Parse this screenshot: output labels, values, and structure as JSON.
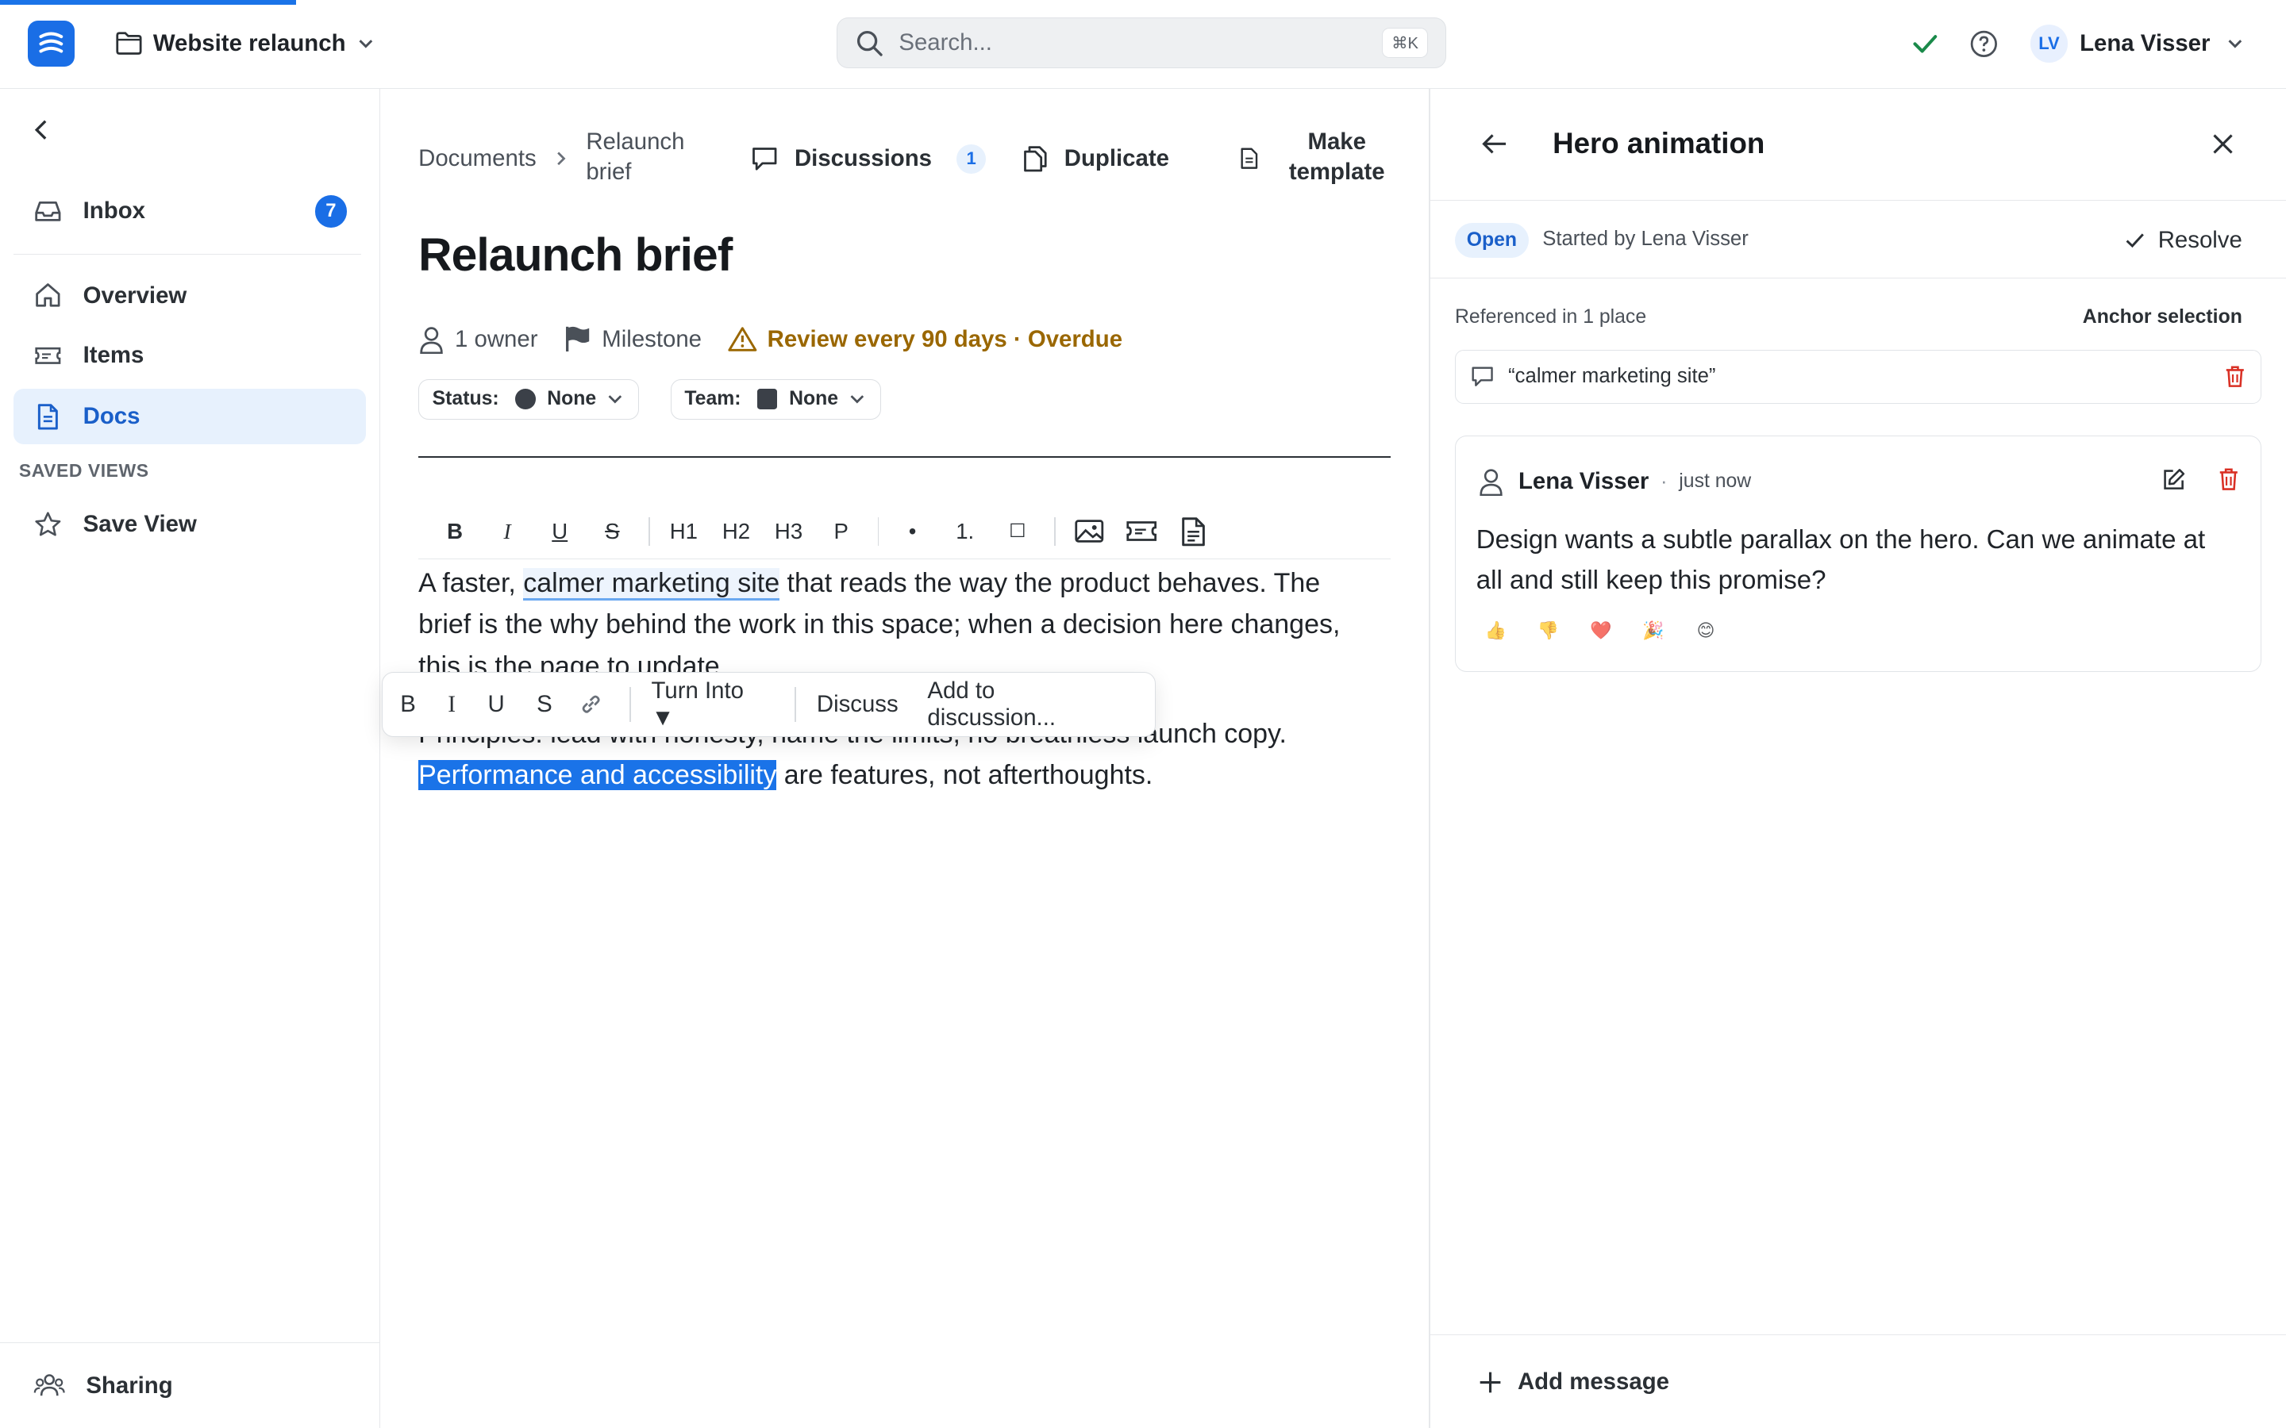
{
  "topbar": {
    "project_name": "Website relaunch",
    "search_placeholder": "Search...",
    "search_shortcut": "⌘K",
    "user_initials": "LV",
    "user_name": "Lena Visser"
  },
  "sidebar": {
    "inbox": {
      "label": "Inbox",
      "count": "7"
    },
    "items": [
      {
        "label": "Overview"
      },
      {
        "label": "Items"
      },
      {
        "label": "Docs"
      }
    ],
    "saved_views_title": "SAVED VIEWS",
    "save_view": "Save View",
    "sharing": "Sharing"
  },
  "document": {
    "breadcrumb_root": "Documents",
    "breadcrumb_current": "Relaunch brief",
    "discussions_label": "Discussions",
    "discussions_count": "1",
    "duplicate_label": "Duplicate",
    "make_template_label": "Make template",
    "title": "Relaunch brief",
    "owners": "1 owner",
    "milestone": "Milestone",
    "review": "Review every 90 days · Overdue",
    "status_key": "Status:",
    "status_value": "None",
    "team_key": "Team:",
    "team_value": "None",
    "toolbar": {
      "bold": "B",
      "italic": "I",
      "underline": "U",
      "strike": "S",
      "h1": "H1",
      "h2": "H2",
      "h3": "H3",
      "p": "P",
      "bullet": "•",
      "ordered": "1.",
      "checkbox": "☐"
    },
    "para1_a": "A faster, ",
    "para1_link": "calmer marketing site",
    "para1_b": " that reads the way the product behaves. The brief is the why behind the work in this space; when a decision here changes, this is the page to update.",
    "para2_a": "Principles: lead with honesty, name the limits, no breathless launch copy. ",
    "para2_selected": "Performance and accessibility",
    "para2_b": " are features, not afterthoughts."
  },
  "floating_toolbar": {
    "bold": "B",
    "italic": "I",
    "underline": "U",
    "strike": "S",
    "turn_into": "Turn Into ▼",
    "discuss": "Discuss",
    "add_to_discussion": "Add to discussion..."
  },
  "discussion_panel": {
    "title": "Hero animation",
    "status": "Open",
    "started_by": "Started by Lena Visser",
    "resolve": "Resolve",
    "referenced": "Referenced in 1 place",
    "anchor_selection": "Anchor selection",
    "quote": "“calmer marketing site”",
    "comment": {
      "author": "Lena Visser",
      "time": "just now",
      "text": "Design wants a subtle parallax on the hero. Can we animate at all and still keep this promise?",
      "reactions": [
        "👍",
        "👎",
        "❤️",
        "🎉",
        "😊"
      ]
    },
    "add_message": "Add message"
  }
}
